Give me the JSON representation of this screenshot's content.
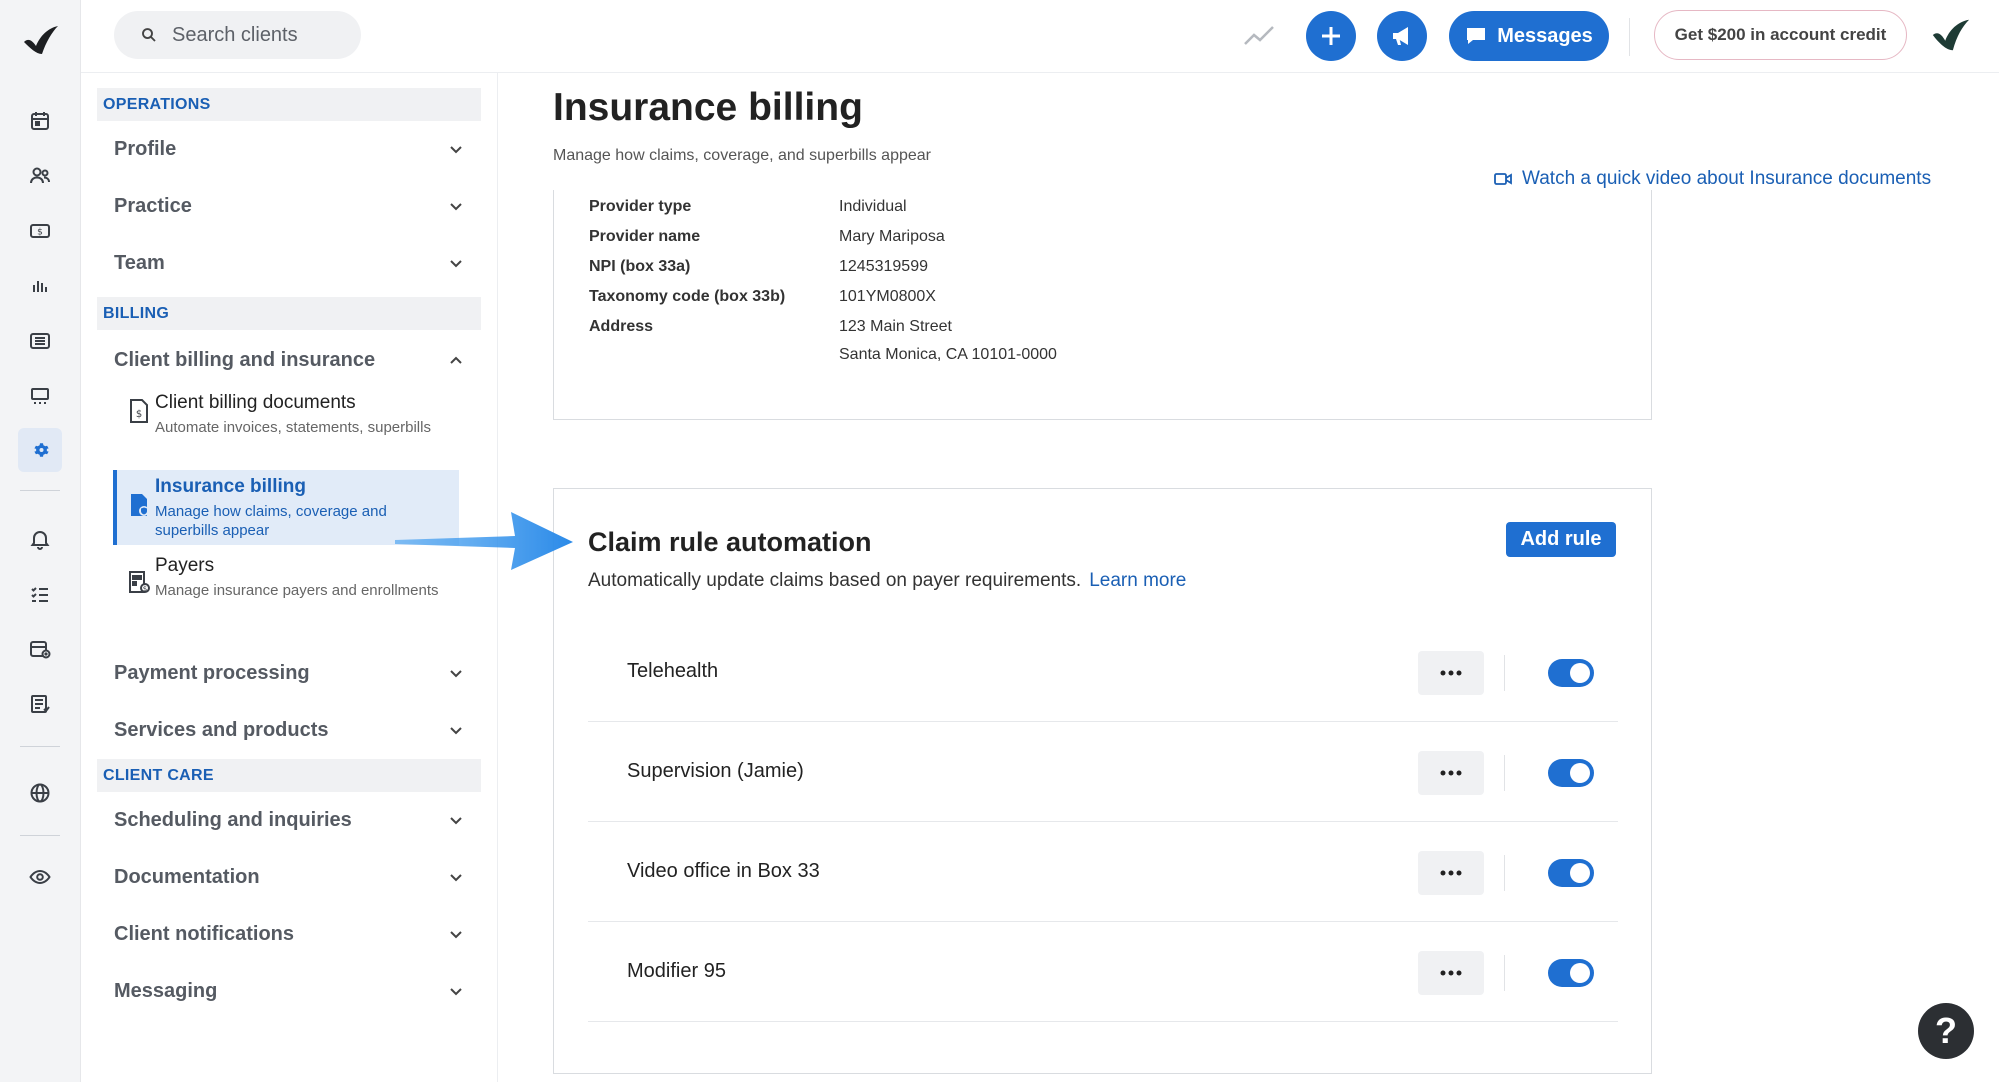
{
  "search": {
    "placeholder": "Search clients"
  },
  "topbar": {
    "messages_label": "Messages",
    "credit_label": "Get $200 in account credit"
  },
  "nav": {
    "operations_header": "OPERATIONS",
    "profile": "Profile",
    "practice": "Practice",
    "team": "Team",
    "billing_header": "BILLING",
    "client_billing": "Client billing and insurance",
    "sub_items": [
      {
        "title": "Client billing documents",
        "desc": "Automate invoices, statements, superbills"
      },
      {
        "title": "Insurance billing",
        "desc": "Manage how claims, coverage and superbills appear"
      },
      {
        "title": "Payers",
        "desc": "Manage insurance payers and enrollments"
      }
    ],
    "payment_processing": "Payment processing",
    "services_products": "Services and products",
    "client_care_header": "CLIENT CARE",
    "scheduling": "Scheduling and inquiries",
    "documentation": "Documentation",
    "client_notifications": "Client notifications",
    "messaging": "Messaging"
  },
  "page": {
    "title": "Insurance billing",
    "subtitle": "Manage how claims, coverage, and superbills appear",
    "video_link": "Watch a quick video about Insurance documents"
  },
  "provider": {
    "rows": [
      {
        "key": "Provider type",
        "value": "Individual"
      },
      {
        "key": "Provider name",
        "value": "Mary Mariposa"
      },
      {
        "key": "NPI (box 33a)",
        "value": "1245319599"
      },
      {
        "key": "Taxonomy code (box 33b)",
        "value": "101YM0800X"
      },
      {
        "key": "Address",
        "value": "123 Main Street"
      }
    ],
    "address_line2": "Santa Monica, CA 10101-0000"
  },
  "claim_rules": {
    "title": "Claim rule automation",
    "description": "Automatically update claims based on payer requirements.",
    "learn_more": "Learn more",
    "add_rule": "Add rule",
    "rules": [
      {
        "name": "Telehealth",
        "enabled": true
      },
      {
        "name": "Supervision (Jamie)",
        "enabled": true
      },
      {
        "name": "Video office in Box 33",
        "enabled": true
      },
      {
        "name": "Modifier 95",
        "enabled": true
      }
    ]
  },
  "help": {
    "label": "?"
  },
  "colors": {
    "accent": "#1f6fd1",
    "link": "#1a5fb4"
  }
}
